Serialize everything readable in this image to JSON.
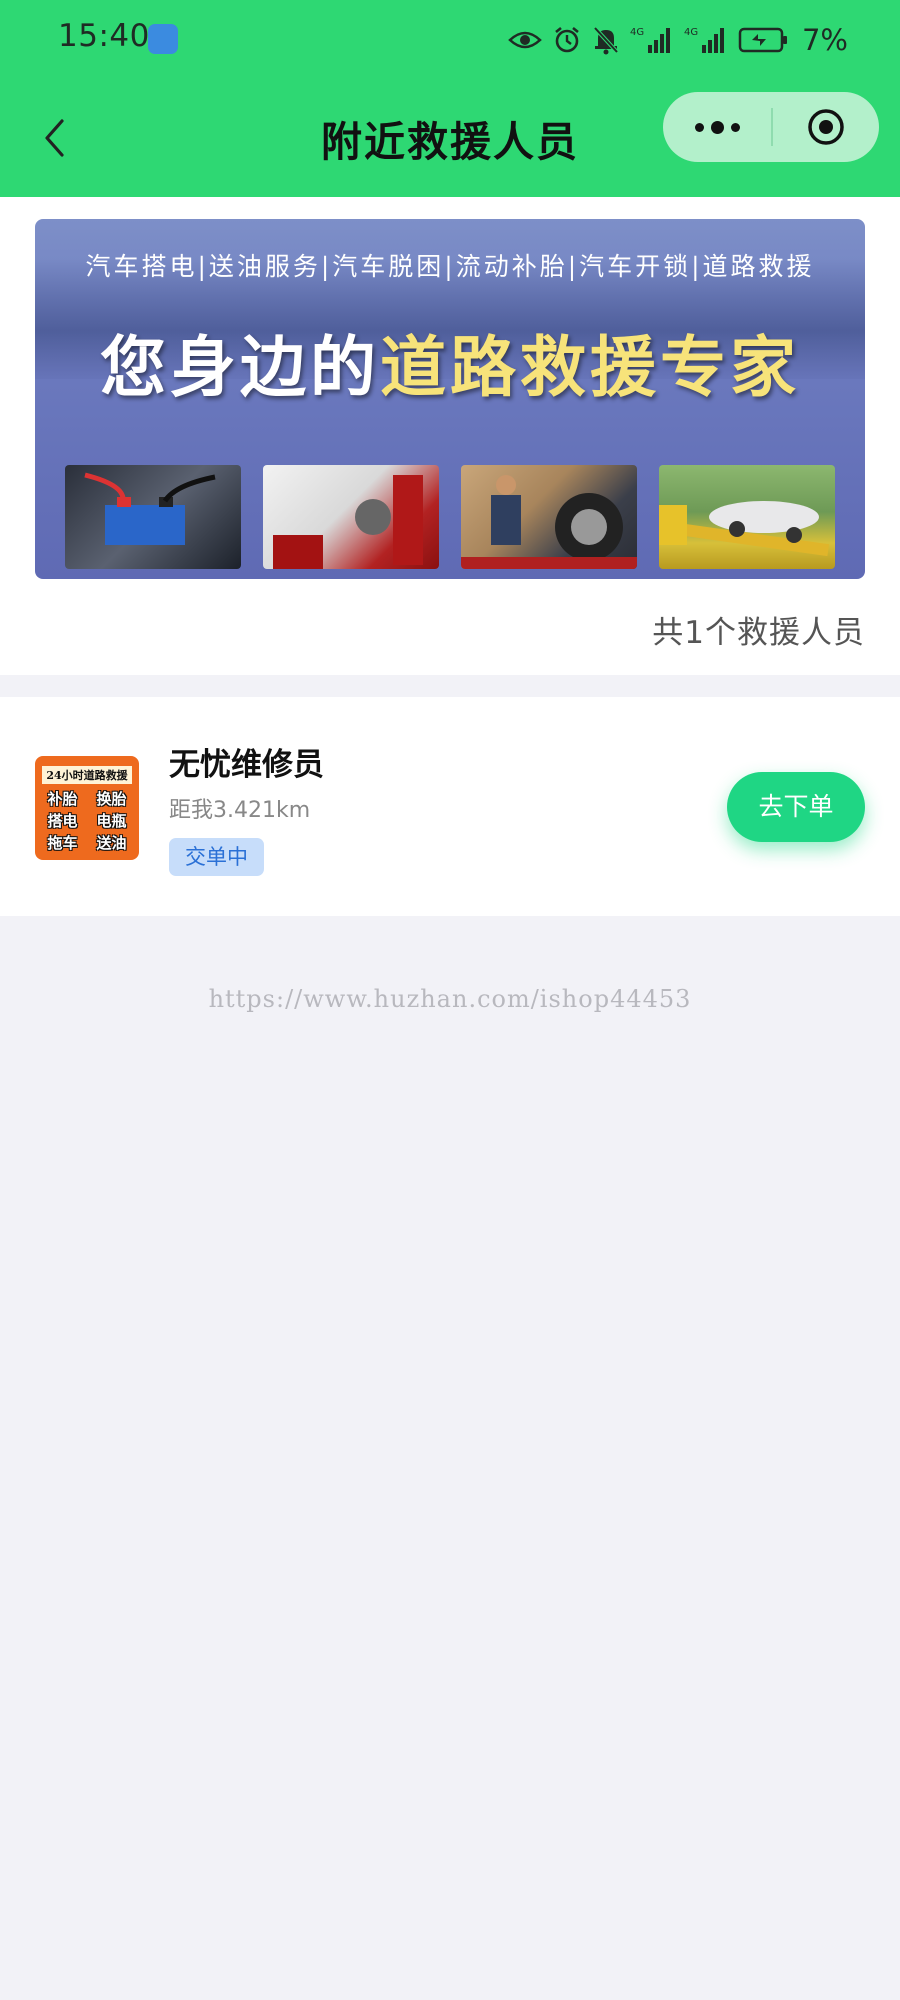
{
  "status_bar": {
    "time": "15:40",
    "network_1": "4G",
    "network_2": "4G",
    "battery": "7%"
  },
  "nav": {
    "title": "附近救援人员"
  },
  "banner": {
    "services": "汽车搭电|送油服务|汽车脱困|流动补胎|汽车开锁|道路救援",
    "slogan_white": "您身边的",
    "slogan_yellow": "道路救援专家"
  },
  "summary": {
    "count_text": "共1个救援人员"
  },
  "rescuers": [
    {
      "avatar_top": "24小时道路救援",
      "avatar_services": [
        "补胎",
        "换胎",
        "搭电",
        "电瓶",
        "拖车",
        "送油"
      ],
      "name": "无忧维修员",
      "distance": "距我3.421km",
      "status": "交单中",
      "action": "去下单"
    }
  ],
  "watermark": "https://www.huzhan.com/ishop44453",
  "colors": {
    "header": "#2ed873",
    "accent_button": "#1fd684",
    "badge_bg": "#c7ddfa",
    "badge_text": "#2a70d6",
    "page_bg": "#f2f2f7"
  },
  "icons": [
    "back-arrow-icon",
    "more-dots-icon",
    "close-target-icon",
    "eye-icon",
    "alarm-icon",
    "bell-off-icon",
    "signal-icon",
    "battery-icon"
  ]
}
